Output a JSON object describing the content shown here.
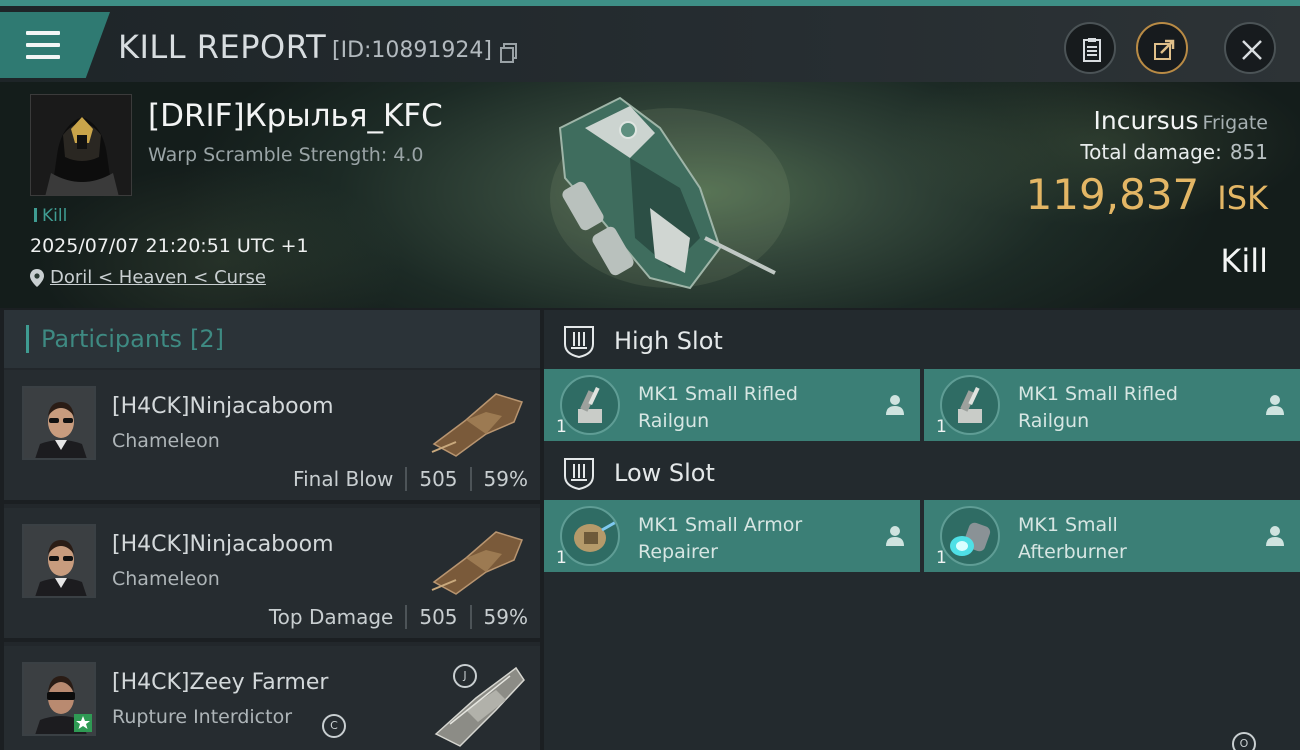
{
  "header": {
    "title": "KILL REPORT",
    "report_id": "[ID:10891924]"
  },
  "victim": {
    "name": "[DRIF]Крылья_KFC",
    "subtitle": "Warp Scramble Strength: 4.0",
    "tag": "Kill",
    "time": "2025/07/07 21:20:51 UTC +1",
    "location": "Doril < Heaven < Curse",
    "ship": "Incursus",
    "ship_class": "Frigate",
    "total_damage_label": "Total damage:",
    "total_damage": "851",
    "isk_value": "119,837",
    "isk_unit": "ISK",
    "result": "Kill"
  },
  "participants": {
    "label": "Participants",
    "count": "[2]",
    "rows": [
      {
        "name": "[H4CK]Ninjacaboom",
        "ship": "Chameleon",
        "stat_label": "Final Blow",
        "damage": "505",
        "percent": "59%"
      },
      {
        "name": "[H4CK]Ninjacaboom",
        "ship": "Chameleon",
        "stat_label": "Top Damage",
        "damage": "505",
        "percent": "59%"
      },
      {
        "name": "[H4CK]Zeey Farmer",
        "ship": "Rupture Interdictor",
        "badge": "C",
        "ship_badge": "J"
      }
    ]
  },
  "fitting": {
    "high_slot_label": "High Slot",
    "low_slot_label": "Low Slot",
    "high": [
      {
        "name_line1": "MK1 Small Rifled",
        "name_line2": "Railgun",
        "qty": "1"
      },
      {
        "name_line1": "MK1 Small Rifled",
        "name_line2": "Railgun",
        "qty": "1"
      }
    ],
    "low": [
      {
        "name_line1": "MK1 Small Armor",
        "name_line2": "Repairer",
        "qty": "1"
      },
      {
        "name_line1": "MK1 Small",
        "name_line2": "Afterburner",
        "qty": "1"
      }
    ],
    "corner_badge": "O"
  },
  "colors": {
    "accent": "#3f9c92",
    "isk": "#e3b665",
    "module_bg": "#3b7f76"
  },
  "icons": [
    "menu-icon",
    "copy-icon",
    "clipboard-icon",
    "share-icon",
    "close-icon",
    "location-pin-icon",
    "shield-slot-icon",
    "person-icon",
    "star-icon"
  ]
}
